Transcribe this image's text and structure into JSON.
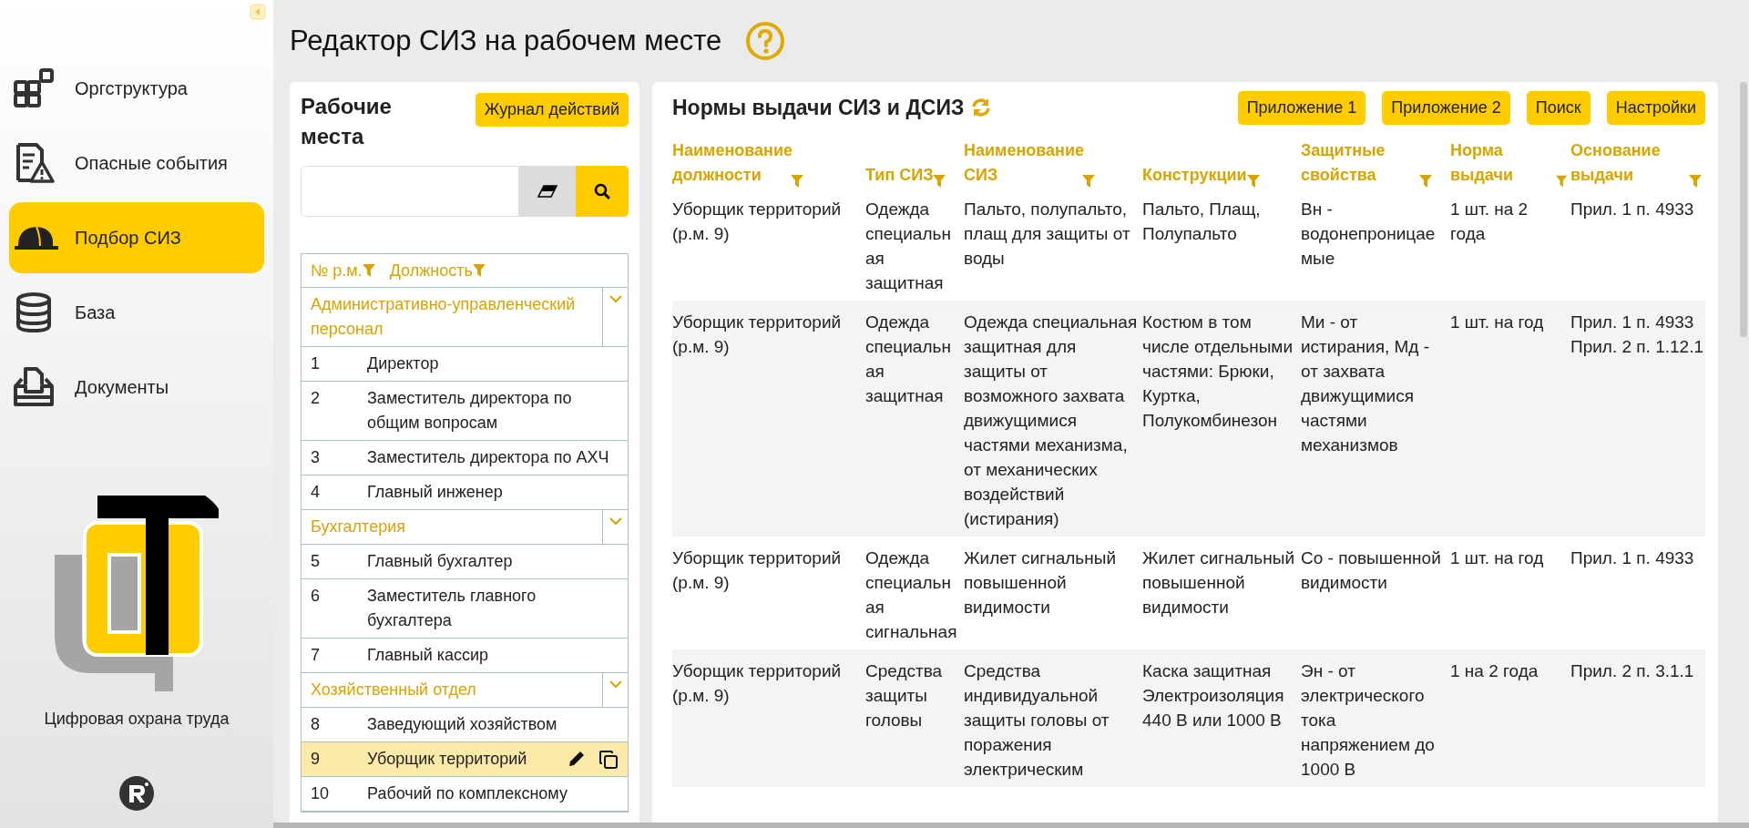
{
  "sidebar": {
    "items": [
      {
        "label": "Оргструктура",
        "selected": false
      },
      {
        "label": "Опасные события",
        "selected": false
      },
      {
        "label": "Подбор СИЗ",
        "selected": true
      },
      {
        "label": "База",
        "selected": false
      },
      {
        "label": "Документы",
        "selected": false
      }
    ],
    "caption": "Цифровая охрана труда"
  },
  "page_title": "Редактор СИЗ на рабочем месте",
  "workplaces": {
    "title": "Рабочие места",
    "log_button": "Журнал действий",
    "columns": [
      "№ р.м.",
      "Должность"
    ],
    "groups": [
      {
        "name": "Административно-управленческий персонал",
        "expanded": true,
        "rows": [
          {
            "number": "1",
            "position": "Директор",
            "selected": false
          },
          {
            "number": "2",
            "position": "Заместитель директора по общим вопросам",
            "selected": false
          },
          {
            "number": "3",
            "position": "Заместитель директора по АХЧ",
            "selected": false
          },
          {
            "number": "4",
            "position": "Главный инженер",
            "selected": false
          }
        ]
      },
      {
        "name": "Бухгалтерия",
        "expanded": true,
        "rows": [
          {
            "number": "5",
            "position": "Главный бухгалтер",
            "selected": false
          },
          {
            "number": "6",
            "position": "Заместитель главного бухгалтера",
            "selected": false
          },
          {
            "number": "7",
            "position": "Главный кассир",
            "selected": false
          }
        ]
      },
      {
        "name": "Хозяйственный отдел",
        "expanded": true,
        "rows": [
          {
            "number": "8",
            "position": "Заведующий хозяйством",
            "selected": false
          },
          {
            "number": "9",
            "position": "Уборщик территорий",
            "selected": true
          },
          {
            "number": "10",
            "position": "Рабочий по комплексному",
            "selected": false
          }
        ]
      }
    ]
  },
  "norms": {
    "title": "Нормы выдачи СИЗ и ДСИЗ",
    "buttons": [
      "Приложение 1",
      "Приложение 2",
      "Поиск",
      "Настройки"
    ],
    "columns": [
      "Наименование должности",
      "Тип СИЗ",
      "Наименование СИЗ",
      "Конструкции",
      "Защитные свойства",
      "Норма выдачи",
      "Основание выдачи"
    ],
    "rows": [
      {
        "cells": [
          "Уборщик территорий (р.м. 9)",
          "Одежда специальная защитная",
          "Пальто, полупальто, плащ для защиты от воды",
          "Пальто, Плащ, Полупальто",
          "Вн - водонепроницаемые",
          "1 шт. на 2 года",
          "Прил. 1 п. 4933"
        ]
      },
      {
        "cells": [
          "Уборщик территорий (р.м. 9)",
          "Одежда специальная защитная",
          "Одежда специальная защитная для защиты от возможного захвата движущимися частями механизма, от механических воздействий (истирания)",
          "Костюм в том числе отдельными частями: Брюки, Куртка, Полукомбинезон",
          "Ми - от истирания, Мд - от захвата движущимися частями механизмов",
          "1 шт. на год",
          "Прил. 1 п. 4933 Прил. 2 п. 1.12.1"
        ]
      },
      {
        "cells": [
          "Уборщик территорий (р.м. 9)",
          "Одежда специальная сигнальная",
          "Жилет сигнальный повышенной видимости",
          "Жилет сигнальный повышенной видимости",
          "Со - повышенной видимости",
          "1 шт. на год",
          "Прил. 1 п. 4933"
        ]
      },
      {
        "cells": [
          "Уборщик территорий (р.м. 9)",
          "Средства защиты головы",
          "Средства индивидуальной защиты головы от поражения электрическим",
          "Каска защитная Электроизоляция 440 В или 1000 В",
          "Эн - от электрического тока напряжением до 1000 В",
          "1 на 2 года",
          "Прил. 2 п. 3.1.1"
        ]
      }
    ]
  }
}
